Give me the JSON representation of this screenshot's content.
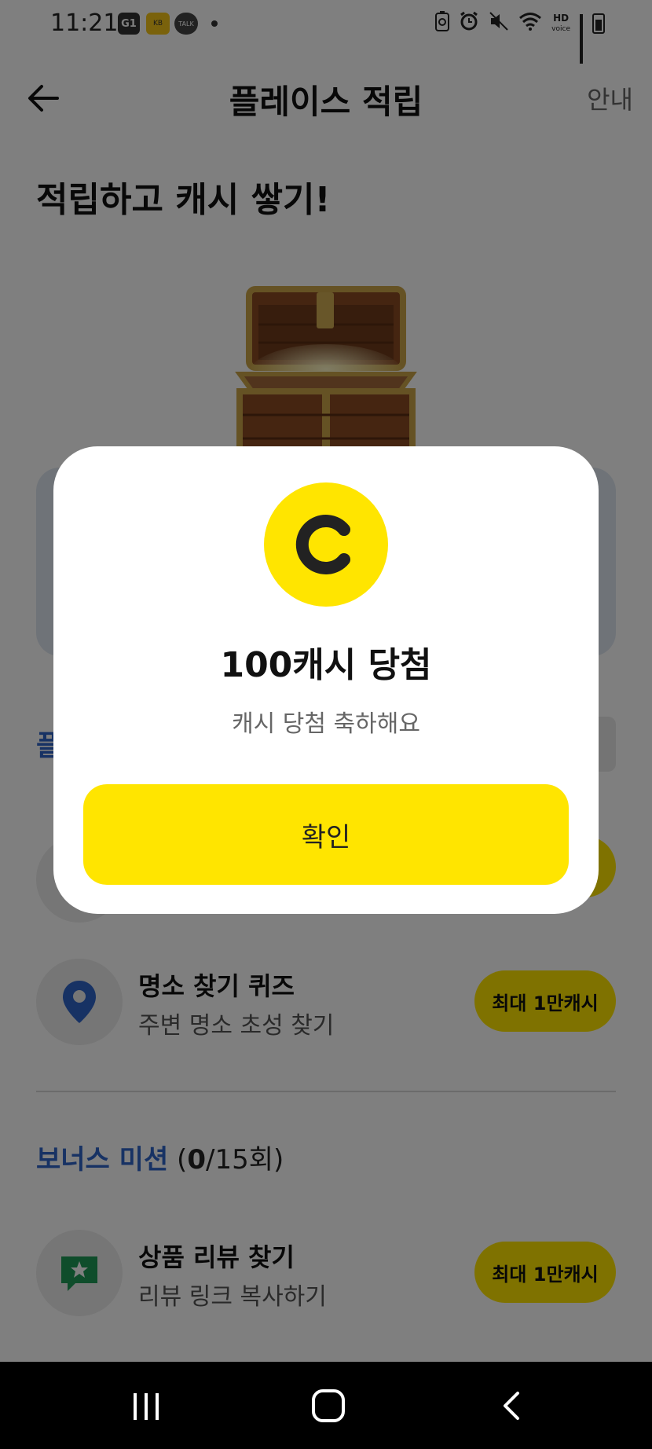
{
  "status_bar": {
    "time": "11:21",
    "icons": [
      "g1-icon",
      "kb-icon",
      "talk-icon",
      "dot-icon",
      "recycle-icon",
      "alarm-icon",
      "mute-icon",
      "wifi-icon",
      "hd-voice-icon",
      "signal-icon",
      "battery-icon"
    ],
    "g1_label": "G1",
    "kb_label": "KB",
    "talk_label": "TALK",
    "hd_label": "HD",
    "voice_label": "voice"
  },
  "header": {
    "back_icon": "arrow-left-icon",
    "title": "플레이스 적립",
    "guide_label": "안내"
  },
  "hero": {
    "title": "적립하고 캐시 쌓기!",
    "image": "treasure-chest"
  },
  "section_peek": {
    "label": "플"
  },
  "list": [
    {
      "icon": "location-pin-icon",
      "title": "명소 찾기 퀴즈",
      "subtitle": "주변 명소 초성 찾기",
      "reward": "최대 1만캐시"
    }
  ],
  "bonus": {
    "title": "보너스 미션",
    "count_open": " (",
    "count_done": "0",
    "count_rest": "/15회)"
  },
  "bonus_list": [
    {
      "icon": "review-star-icon",
      "title": "상품 리뷰 찾기",
      "subtitle": "리뷰 링크 복사하기",
      "reward": "최대 1만캐시"
    }
  ],
  "modal": {
    "coin_icon": "cash-coin-icon",
    "title": "100캐시 당첨",
    "subtitle": "캐시 당첨 축하해요",
    "confirm_label": "확인"
  },
  "nav": {
    "recent_icon": "recent-apps-icon",
    "home_icon": "home-icon",
    "back_icon": "nav-back-icon"
  },
  "colors": {
    "accent_yellow": "#ffe500",
    "accent_blue": "#2f64c8",
    "pin_blue": "#2f64c8",
    "review_green": "#1e9a57"
  }
}
